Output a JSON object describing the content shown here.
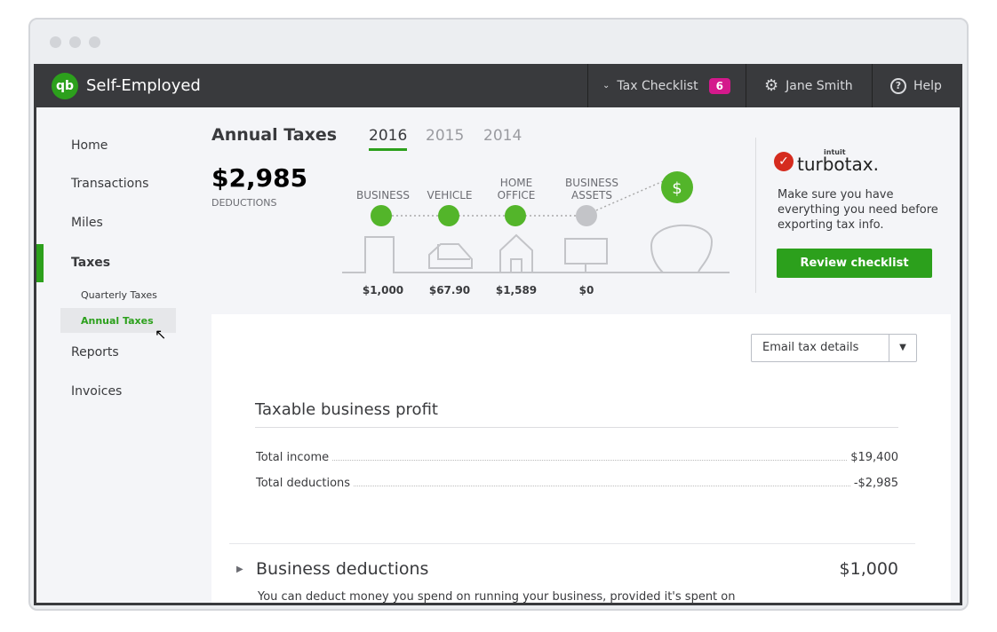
{
  "window": {
    "title": "Self-Employed"
  },
  "header": {
    "tax_checklist": "Tax Checklist",
    "checklist_count": "6",
    "user": "Jane Smith",
    "help": "Help",
    "logo_text": "qb"
  },
  "sidebar": {
    "items": [
      {
        "label": "Home"
      },
      {
        "label": "Transactions"
      },
      {
        "label": "Miles"
      },
      {
        "label": "Taxes"
      },
      {
        "label": "Reports"
      },
      {
        "label": "Invoices"
      }
    ],
    "sub_items": [
      {
        "label": "Quarterly Taxes"
      },
      {
        "label": "Annual Taxes"
      }
    ],
    "active": "Taxes",
    "active_sub": "Annual Taxes"
  },
  "main": {
    "title": "Annual Taxes",
    "years": [
      "2016",
      "2015",
      "2014"
    ],
    "selected_year": "2016",
    "deductions_total": "$2,985",
    "deductions_label": "DEDUCTIONS",
    "categories": [
      {
        "label1": "",
        "label2": "BUSINESS",
        "amount": "$1,000",
        "complete": true
      },
      {
        "label1": "",
        "label2": "VEHICLE",
        "amount": "$67.90",
        "complete": true
      },
      {
        "label1": "HOME",
        "label2": "OFFICE",
        "amount": "$1,589",
        "complete": true
      },
      {
        "label1": "BUSINESS",
        "label2": "ASSETS",
        "amount": "$0",
        "complete": false
      }
    ],
    "dollar_symbol": "$"
  },
  "turbotax": {
    "brand_small": "intuit",
    "brand": "turbotax.",
    "text": "Make sure you have everything you need before exporting tax info.",
    "button": "Review checklist"
  },
  "card": {
    "email_button": "Email tax details",
    "profit_title": "Taxable business profit",
    "rows": [
      {
        "label": "Total income",
        "value": "$19,400"
      },
      {
        "label": "Total deductions",
        "value": "-$2,985"
      }
    ],
    "section_title": "Business deductions",
    "section_value": "$1,000",
    "section_desc": "You can deduct money you spend on running your business, provided it's spent on"
  },
  "colors": {
    "accent": "#2ca01c",
    "badge": "#d4198c",
    "header": "#393a3d"
  }
}
